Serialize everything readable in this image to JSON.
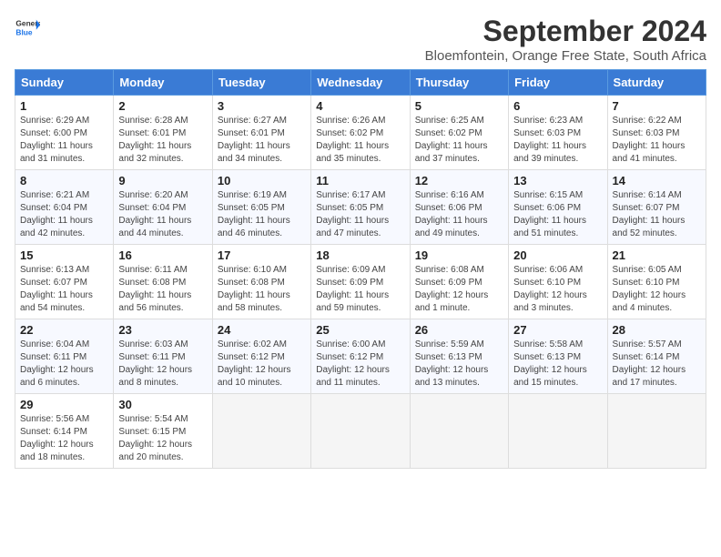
{
  "app": {
    "logo_general": "General",
    "logo_blue": "Blue",
    "title": "September 2024",
    "subtitle": "Bloemfontein, Orange Free State, South Africa"
  },
  "calendar": {
    "headers": [
      "Sunday",
      "Monday",
      "Tuesday",
      "Wednesday",
      "Thursday",
      "Friday",
      "Saturday"
    ],
    "weeks": [
      [
        {
          "day": "",
          "info": ""
        },
        {
          "day": "2",
          "info": "Sunrise: 6:28 AM\nSunset: 6:01 PM\nDaylight: 11 hours\nand 32 minutes."
        },
        {
          "day": "3",
          "info": "Sunrise: 6:27 AM\nSunset: 6:01 PM\nDaylight: 11 hours\nand 34 minutes."
        },
        {
          "day": "4",
          "info": "Sunrise: 6:26 AM\nSunset: 6:02 PM\nDaylight: 11 hours\nand 35 minutes."
        },
        {
          "day": "5",
          "info": "Sunrise: 6:25 AM\nSunset: 6:02 PM\nDaylight: 11 hours\nand 37 minutes."
        },
        {
          "day": "6",
          "info": "Sunrise: 6:23 AM\nSunset: 6:03 PM\nDaylight: 11 hours\nand 39 minutes."
        },
        {
          "day": "7",
          "info": "Sunrise: 6:22 AM\nSunset: 6:03 PM\nDaylight: 11 hours\nand 41 minutes."
        }
      ],
      [
        {
          "day": "8",
          "info": "Sunrise: 6:21 AM\nSunset: 6:04 PM\nDaylight: 11 hours\nand 42 minutes."
        },
        {
          "day": "9",
          "info": "Sunrise: 6:20 AM\nSunset: 6:04 PM\nDaylight: 11 hours\nand 44 minutes."
        },
        {
          "day": "10",
          "info": "Sunrise: 6:19 AM\nSunset: 6:05 PM\nDaylight: 11 hours\nand 46 minutes."
        },
        {
          "day": "11",
          "info": "Sunrise: 6:17 AM\nSunset: 6:05 PM\nDaylight: 11 hours\nand 47 minutes."
        },
        {
          "day": "12",
          "info": "Sunrise: 6:16 AM\nSunset: 6:06 PM\nDaylight: 11 hours\nand 49 minutes."
        },
        {
          "day": "13",
          "info": "Sunrise: 6:15 AM\nSunset: 6:06 PM\nDaylight: 11 hours\nand 51 minutes."
        },
        {
          "day": "14",
          "info": "Sunrise: 6:14 AM\nSunset: 6:07 PM\nDaylight: 11 hours\nand 52 minutes."
        }
      ],
      [
        {
          "day": "15",
          "info": "Sunrise: 6:13 AM\nSunset: 6:07 PM\nDaylight: 11 hours\nand 54 minutes."
        },
        {
          "day": "16",
          "info": "Sunrise: 6:11 AM\nSunset: 6:08 PM\nDaylight: 11 hours\nand 56 minutes."
        },
        {
          "day": "17",
          "info": "Sunrise: 6:10 AM\nSunset: 6:08 PM\nDaylight: 11 hours\nand 58 minutes."
        },
        {
          "day": "18",
          "info": "Sunrise: 6:09 AM\nSunset: 6:09 PM\nDaylight: 11 hours\nand 59 minutes."
        },
        {
          "day": "19",
          "info": "Sunrise: 6:08 AM\nSunset: 6:09 PM\nDaylight: 12 hours\nand 1 minute."
        },
        {
          "day": "20",
          "info": "Sunrise: 6:06 AM\nSunset: 6:10 PM\nDaylight: 12 hours\nand 3 minutes."
        },
        {
          "day": "21",
          "info": "Sunrise: 6:05 AM\nSunset: 6:10 PM\nDaylight: 12 hours\nand 4 minutes."
        }
      ],
      [
        {
          "day": "22",
          "info": "Sunrise: 6:04 AM\nSunset: 6:11 PM\nDaylight: 12 hours\nand 6 minutes."
        },
        {
          "day": "23",
          "info": "Sunrise: 6:03 AM\nSunset: 6:11 PM\nDaylight: 12 hours\nand 8 minutes."
        },
        {
          "day": "24",
          "info": "Sunrise: 6:02 AM\nSunset: 6:12 PM\nDaylight: 12 hours\nand 10 minutes."
        },
        {
          "day": "25",
          "info": "Sunrise: 6:00 AM\nSunset: 6:12 PM\nDaylight: 12 hours\nand 11 minutes."
        },
        {
          "day": "26",
          "info": "Sunrise: 5:59 AM\nSunset: 6:13 PM\nDaylight: 12 hours\nand 13 minutes."
        },
        {
          "day": "27",
          "info": "Sunrise: 5:58 AM\nSunset: 6:13 PM\nDaylight: 12 hours\nand 15 minutes."
        },
        {
          "day": "28",
          "info": "Sunrise: 5:57 AM\nSunset: 6:14 PM\nDaylight: 12 hours\nand 17 minutes."
        }
      ],
      [
        {
          "day": "29",
          "info": "Sunrise: 5:56 AM\nSunset: 6:14 PM\nDaylight: 12 hours\nand 18 minutes."
        },
        {
          "day": "30",
          "info": "Sunrise: 5:54 AM\nSunset: 6:15 PM\nDaylight: 12 hours\nand 20 minutes."
        },
        {
          "day": "",
          "info": ""
        },
        {
          "day": "",
          "info": ""
        },
        {
          "day": "",
          "info": ""
        },
        {
          "day": "",
          "info": ""
        },
        {
          "day": "",
          "info": ""
        }
      ]
    ],
    "week1_day1": {
      "day": "1",
      "info": "Sunrise: 6:29 AM\nSunset: 6:00 PM\nDaylight: 11 hours\nand 31 minutes."
    }
  }
}
